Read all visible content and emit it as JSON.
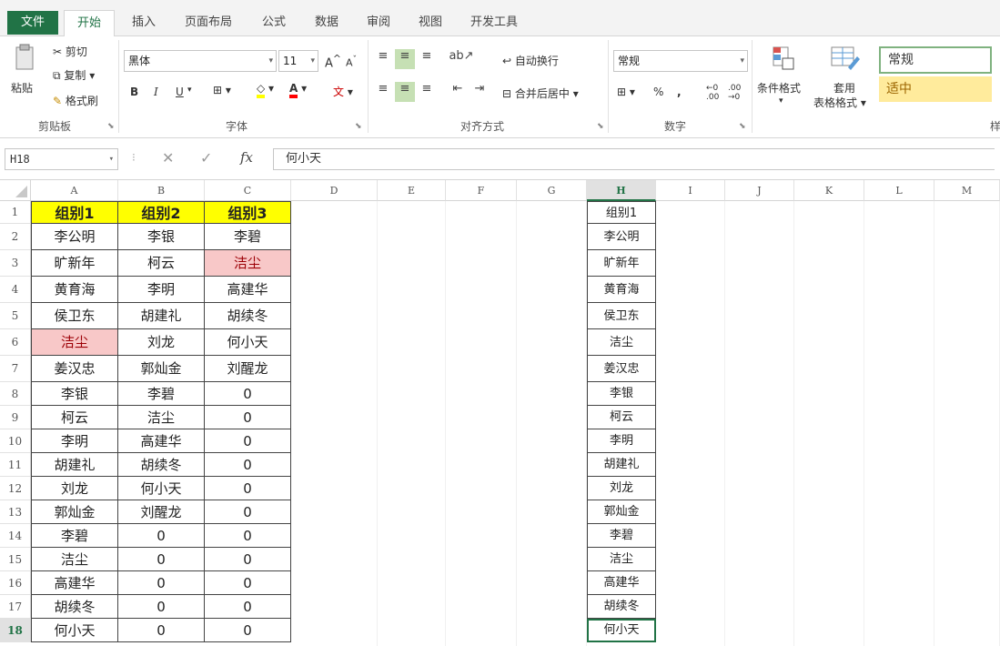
{
  "ribbon_tabs": [
    "文件",
    "开始",
    "插入",
    "页面布局",
    "公式",
    "数据",
    "审阅",
    "视图",
    "开发工具"
  ],
  "clipboard": {
    "paste": "粘贴",
    "cut": "剪切",
    "copy": "复制",
    "format_painter": "格式刷",
    "group_label": "剪贴板"
  },
  "font": {
    "font_name": "黑体",
    "font_size": "11",
    "bold": "B",
    "italic": "I",
    "underline": "U",
    "grow": "A",
    "shrink": "A",
    "wen": "文",
    "group_label": "字体"
  },
  "alignment": {
    "wrap_text": "自动换行",
    "merge_center": "合并后居中",
    "group_label": "对齐方式"
  },
  "number": {
    "format": "常规",
    "percent": "%",
    "comma": ",",
    "group_label": "数字"
  },
  "styles": {
    "conditional_format": "条件格式",
    "table_format_1": "套用",
    "table_format_2": "表格格式",
    "style_normal": "常规",
    "style_neutral": "适中",
    "group_label": "样"
  },
  "formula_bar": {
    "name_box": "H18",
    "fx": "fx",
    "content": "何小天"
  },
  "columns": [
    "A",
    "B",
    "C",
    "D",
    "E",
    "F",
    "G",
    "H",
    "I",
    "J",
    "K",
    "L",
    "M"
  ],
  "rows": [
    "1",
    "2",
    "3",
    "4",
    "5",
    "6",
    "7",
    "8",
    "9",
    "10",
    "11",
    "12",
    "13",
    "14",
    "15",
    "16",
    "17",
    "18"
  ],
  "table": [
    [
      "组别1",
      "组别2",
      "组别3"
    ],
    [
      "李公明",
      "李银",
      "李碧"
    ],
    [
      "旷新年",
      "柯云",
      "洁尘"
    ],
    [
      "黄育海",
      "李明",
      "高建华"
    ],
    [
      "侯卫东",
      "胡建礼",
      "胡续冬"
    ],
    [
      "洁尘",
      "刘龙",
      "何小天"
    ],
    [
      "姜汉忠",
      "郭灿金",
      "刘醒龙"
    ],
    [
      "李银",
      "李碧",
      "0"
    ],
    [
      "柯云",
      "洁尘",
      "0"
    ],
    [
      "李明",
      "高建华",
      "0"
    ],
    [
      "胡建礼",
      "胡续冬",
      "0"
    ],
    [
      "刘龙",
      "何小天",
      "0"
    ],
    [
      "郭灿金",
      "刘醒龙",
      "0"
    ],
    [
      "李碧",
      "0",
      "0"
    ],
    [
      "洁尘",
      "0",
      "0"
    ],
    [
      "高建华",
      "0",
      "0"
    ],
    [
      "胡续冬",
      "0",
      "0"
    ],
    [
      "何小天",
      "0",
      "0"
    ]
  ],
  "column_h": [
    "组别1",
    "李公明",
    "旷新年",
    "黄育海",
    "侯卫东",
    "洁尘",
    "姜汉忠",
    "李银",
    "柯云",
    "李明",
    "胡建礼",
    "刘龙",
    "郭灿金",
    "李碧",
    "洁尘",
    "高建华",
    "胡续冬",
    "何小天"
  ],
  "colors": {
    "accent": "#217346",
    "header_fill": "#ffff00",
    "duplicate_fill": "#f8c8c8",
    "duplicate_text": "#9c0006"
  }
}
